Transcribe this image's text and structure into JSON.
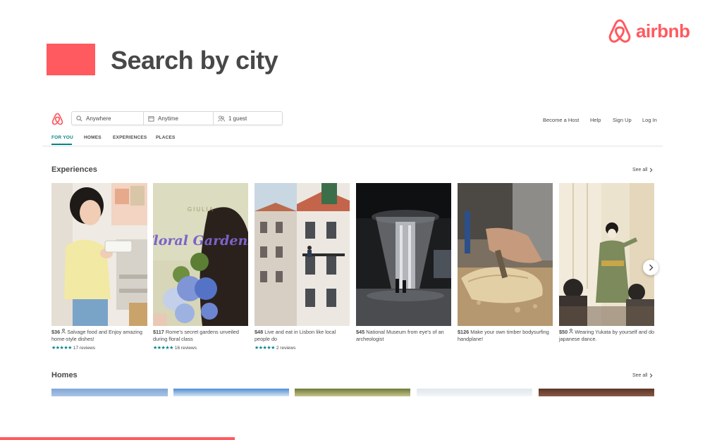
{
  "slide": {
    "title": "Search by city",
    "brand_name": "airbnb",
    "accent_color": "#FF5A5F"
  },
  "header": {
    "logo_icon": "airbnb-belo-icon",
    "search": {
      "where": "Anywhere",
      "when": "Anytime",
      "guests": "1 guest"
    },
    "links": {
      "become_host": "Become a Host",
      "help": "Help",
      "sign_up": "Sign Up",
      "log_in": "Log In"
    },
    "tabs": [
      {
        "label": "FOR YOU",
        "active": true
      },
      {
        "label": "HOMES",
        "active": false
      },
      {
        "label": "EXPERIENCES",
        "active": false
      },
      {
        "label": "PLACES",
        "active": false
      }
    ]
  },
  "experiences": {
    "title": "Experiences",
    "see_all": "See all",
    "cards": [
      {
        "price": "$36",
        "price_icon": "person-icon",
        "description": "Salvage food and Enjoy amazing home-style dishes!",
        "stars": "★★★★★",
        "reviews": "17 reviews"
      },
      {
        "price": "$117",
        "description": "Rome's secret gardens unveiled during floral class",
        "stars": "★★★★★",
        "reviews": "16 reviews",
        "image_text_top": "GIULIA",
        "image_text_main": "Floral Gardens"
      },
      {
        "price": "$48",
        "description": "Live and eat in Lisbon like local people do",
        "stars": "★★★★★",
        "reviews": "2 reviews"
      },
      {
        "price": "$45",
        "description": "National Museum from eye's of an archeologist"
      },
      {
        "price": "$126",
        "description": "Make your own timber bodysurfing handplane!"
      },
      {
        "price": "$50",
        "price_icon": "person-icon",
        "description": "Wearing Yukata by yourself and do japanese dance."
      }
    ]
  },
  "homes": {
    "title": "Homes",
    "see_all": "See all"
  },
  "colors": {
    "teal": "#008489",
    "text": "#484848"
  }
}
